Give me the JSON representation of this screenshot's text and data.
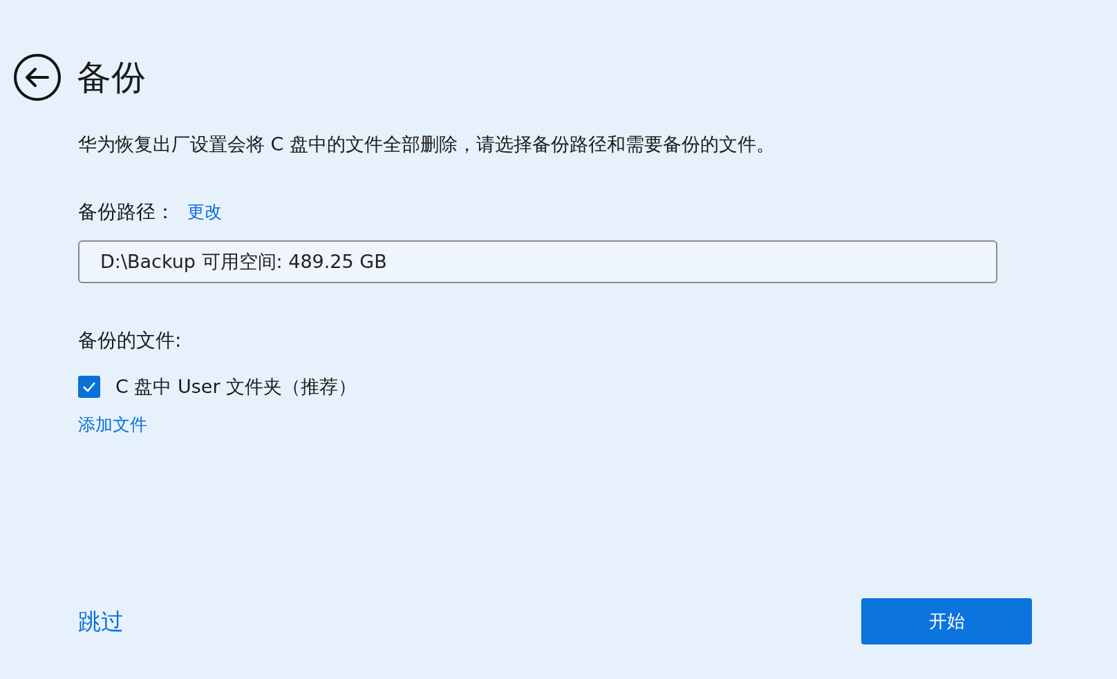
{
  "header": {
    "title": "备份"
  },
  "description": "华为恢复出厂设置会将 C 盘中的文件全部删除，请选择备份路径和需要备份的文件。",
  "backup_path": {
    "label": "备份路径：",
    "change_link": "更改",
    "value": "D:\\Backup 可用空间: 489.25 GB"
  },
  "files": {
    "label": "备份的文件:",
    "items": [
      {
        "label": "C 盘中 User 文件夹（推荐）",
        "checked": true
      }
    ],
    "add_link": "添加文件"
  },
  "footer": {
    "skip": "跳过",
    "start": "开始"
  }
}
